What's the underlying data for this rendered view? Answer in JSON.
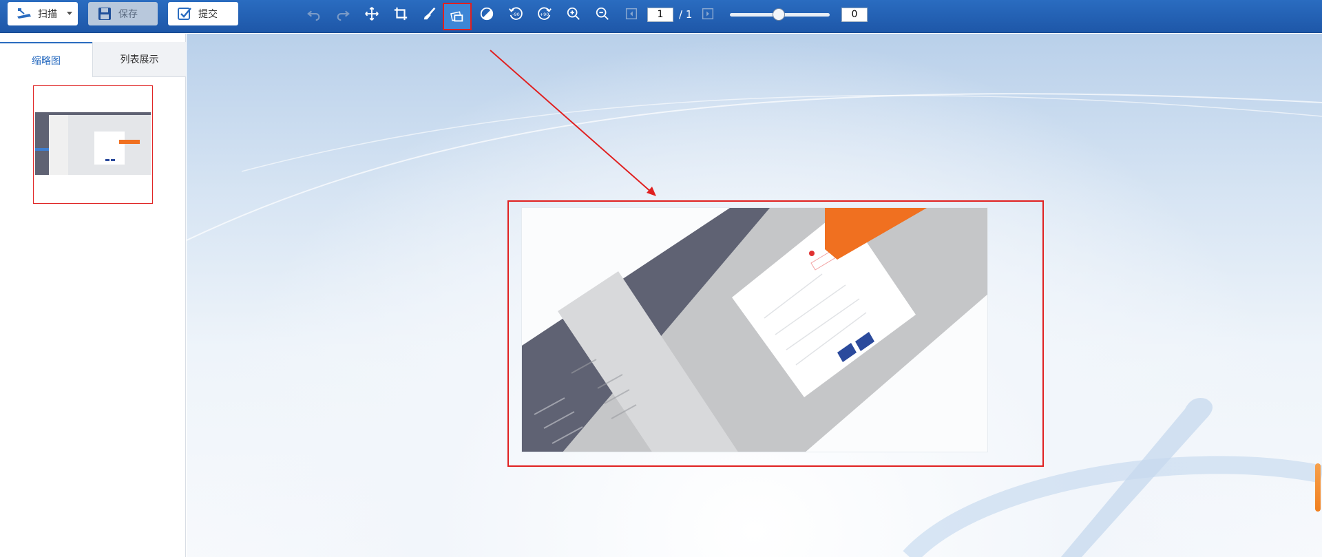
{
  "toolbar": {
    "scan_label": "扫描",
    "save_label": "保存",
    "submit_label": "提交",
    "tools": [
      "undo-icon",
      "redo-icon",
      "move-icon",
      "crop-icon",
      "brush-icon",
      "image-adjust-icon",
      "contrast-icon",
      "rotate-left-90-icon",
      "rotate-right-90-icon",
      "zoom-in-icon",
      "zoom-out-icon",
      "prev-page-icon",
      "next-page-icon"
    ],
    "rotate_left_label": "-90",
    "rotate_right_label": "+90",
    "current_page": "1",
    "page_total": "/ 1",
    "slider_value": "0"
  },
  "sidebar": {
    "tab_thumbnails": "缩略图",
    "tab_list": "列表展示"
  },
  "colors": {
    "toolbar_blue": "#2a6cc0",
    "highlight_red": "#e02020",
    "active_tool": "#3d86d6",
    "accent_orange": "#f07020",
    "app_dark": "#5f6273"
  }
}
